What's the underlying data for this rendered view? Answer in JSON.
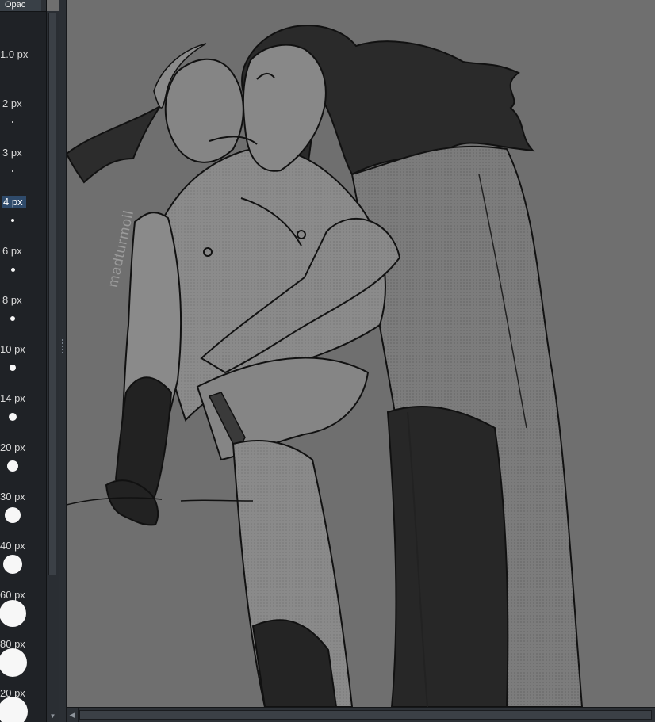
{
  "toolbar": {
    "opacity_label": "Opac",
    "dropdown_icon": "chevron-down-icon"
  },
  "brushes": [
    {
      "label": "1.0 px",
      "size": 1
    },
    {
      "label": "2 px",
      "size": 2
    },
    {
      "label": "3 px",
      "size": 3
    },
    {
      "label": "4 px",
      "size": 4,
      "selected": true
    },
    {
      "label": "6 px",
      "size": 6
    },
    {
      "label": "8 px",
      "size": 8
    },
    {
      "label": "10 px",
      "size": 10
    },
    {
      "label": "14 px",
      "size": 14
    },
    {
      "label": "20 px",
      "size": 20
    },
    {
      "label": "30 px",
      "size": 30
    },
    {
      "label": "40 px",
      "size": 40
    },
    {
      "label": "60 px",
      "size": 60
    },
    {
      "label": "80 px",
      "size": 80
    },
    {
      "label": "20 px",
      "size": 120
    }
  ],
  "canvas": {
    "watermark": "madturmoil"
  },
  "colors": {
    "panel": "#1f2226",
    "canvas": "#6f6f6f",
    "selected": "#2f4b6b",
    "text": "#d8d8d8"
  }
}
